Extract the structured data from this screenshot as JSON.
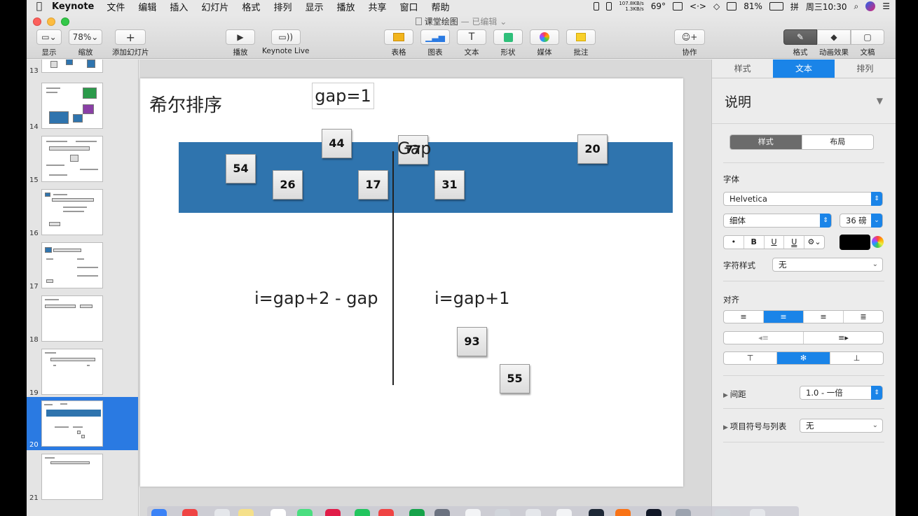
{
  "menubar": {
    "app_name": "Keynote",
    "items": [
      "文件",
      "编辑",
      "插入",
      "幻灯片",
      "格式",
      "排列",
      "显示",
      "播放",
      "共享",
      "窗口",
      "帮助"
    ],
    "net_up": "107.8KB/s",
    "net_down": "1.3KB/s",
    "temperature": "69°",
    "battery": "81%",
    "clock": "周三10:30"
  },
  "window": {
    "title": "课堂绘图",
    "subtitle": " — 已编辑"
  },
  "toolbar": {
    "view_label": "显示",
    "zoom_value": "78%",
    "zoom_label": "缩放",
    "add_slide_label": "添加幻灯片",
    "play_label": "播放",
    "keynote_live_label": "Keynote Live",
    "table_label": "表格",
    "chart_label": "图表",
    "text_label": "文本",
    "shape_label": "形状",
    "media_label": "媒体",
    "comment_label": "批注",
    "collaborate_label": "协作",
    "format_label": "格式",
    "animate_label": "动画效果",
    "document_label": "文稿"
  },
  "navigator": {
    "slides": [
      {
        "number": "13",
        "selected": false
      },
      {
        "number": "14",
        "selected": false
      },
      {
        "number": "15",
        "selected": false
      },
      {
        "number": "16",
        "selected": false
      },
      {
        "number": "17",
        "selected": false
      },
      {
        "number": "18",
        "selected": false
      },
      {
        "number": "19",
        "selected": false
      },
      {
        "number": "20",
        "selected": true
      },
      {
        "number": "21",
        "selected": false
      }
    ]
  },
  "slide": {
    "title": "希尔排序",
    "gap_label": "gap=1",
    "gap_word": "Gap",
    "hidden_number": "77",
    "formula_left": "i=gap+2 - gap",
    "formula_right": "i=gap+1",
    "band_color": "#2f74ae",
    "boxes": [
      "44",
      "20",
      "54",
      "26",
      "17",
      "31",
      "93",
      "55"
    ]
  },
  "inspector": {
    "tabs": [
      "样式",
      "文本",
      "排列"
    ],
    "active_tab": "文本",
    "paragraph_style": "说明",
    "sub_tabs": [
      "样式",
      "布局"
    ],
    "font_section": "字体",
    "font_family": "Helvetica",
    "font_weight": "细体",
    "font_size": "36 磅",
    "char_style_label": "字符样式",
    "char_style_value": "无",
    "align_label": "对齐",
    "spacing_label": "间距",
    "spacing_value": "1.0 - 一倍",
    "bullets_label": "项目符号与列表",
    "bullets_value": "无",
    "text_color": "#000000",
    "accent": "#1a84e8"
  }
}
